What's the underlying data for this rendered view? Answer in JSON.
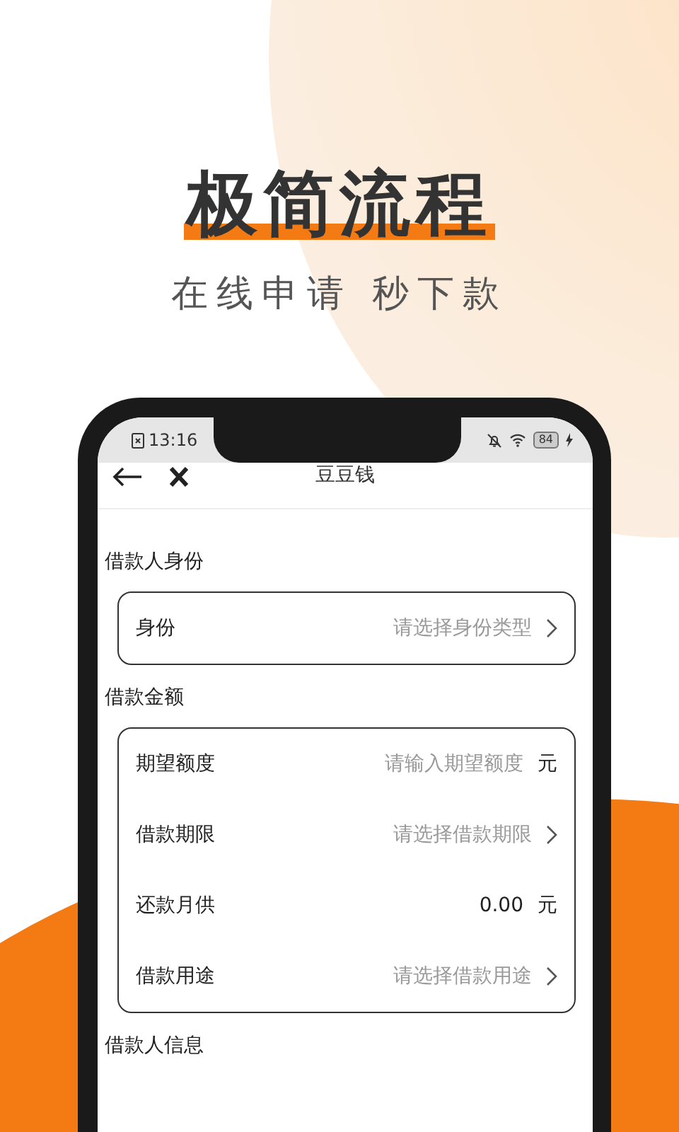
{
  "headline": "极简流程",
  "subtitle": "在线申请 秒下款",
  "status_bar": {
    "time": "13:16",
    "battery": "84"
  },
  "nav": {
    "title": "豆豆钱"
  },
  "sections": [
    {
      "title": "借款人身份",
      "rows": [
        {
          "kind": "select",
          "label": "身份",
          "placeholder": "请选择身份类型"
        }
      ]
    },
    {
      "title": "借款金额",
      "rows": [
        {
          "kind": "input",
          "label": "期望额度",
          "placeholder": "请输入期望额度",
          "unit": "元"
        },
        {
          "kind": "select",
          "label": "借款期限",
          "placeholder": "请选择借款期限"
        },
        {
          "kind": "value",
          "label": "还款月供",
          "value": "0.00",
          "unit": "元"
        },
        {
          "kind": "select",
          "label": "借款用途",
          "placeholder": "请选择借款用途"
        }
      ]
    },
    {
      "title": "借款人信息"
    }
  ]
}
